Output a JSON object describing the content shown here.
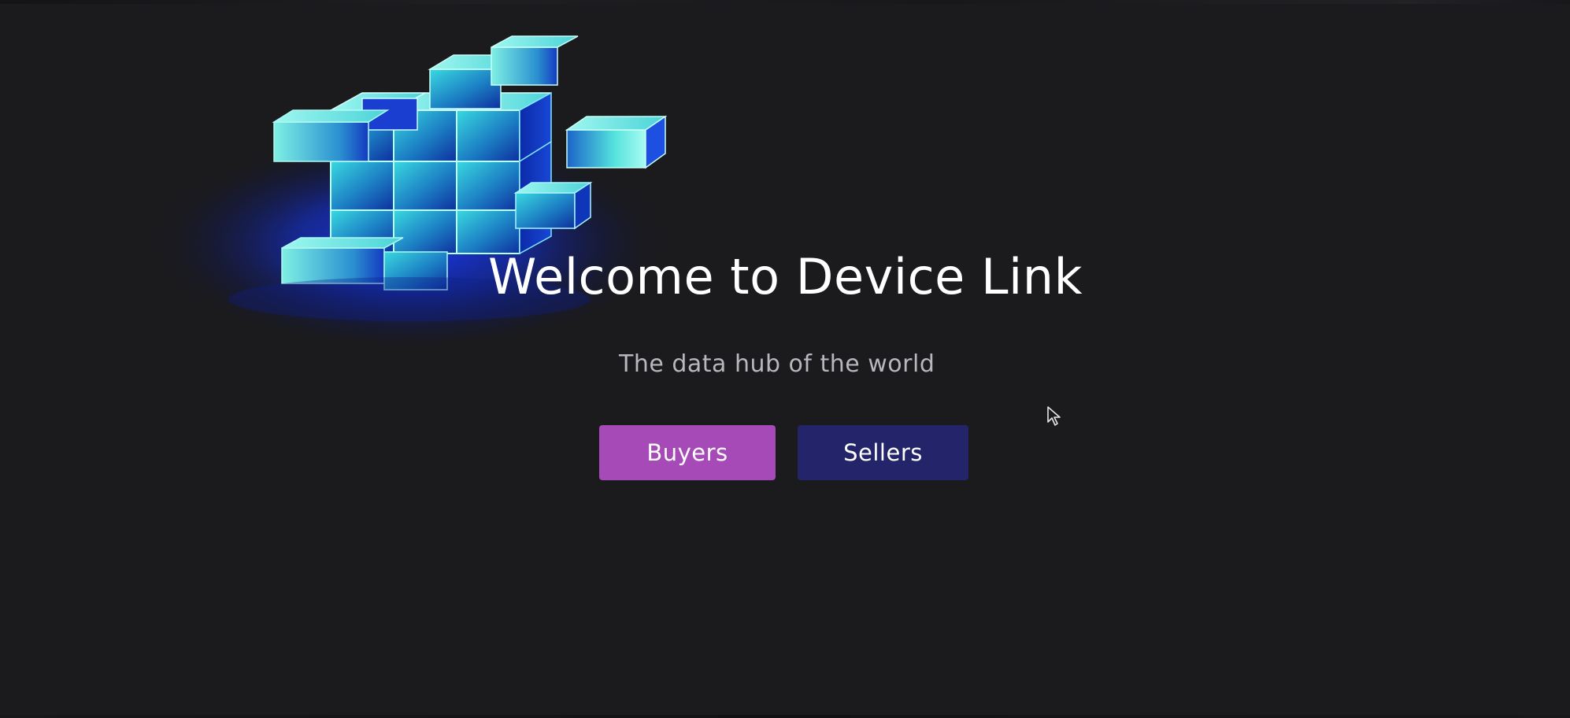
{
  "hero": {
    "title": "Welcome to Device Link",
    "subtitle": "The data hub of the world"
  },
  "actions": {
    "buyers_label": "Buyers",
    "sellers_label": "Sellers"
  },
  "icons": {
    "hero_art": "data-cube-illustration",
    "pointer": "mouse-cursor-icon"
  },
  "colors": {
    "background": "#1b1a1d",
    "title": "#ffffff",
    "subtitle": "#b9b7bd",
    "buyers_button": "#a64ab8",
    "sellers_button": "#23246a",
    "cube_glow": "#1234ff",
    "cube_cyan": "#7ff0e4"
  }
}
